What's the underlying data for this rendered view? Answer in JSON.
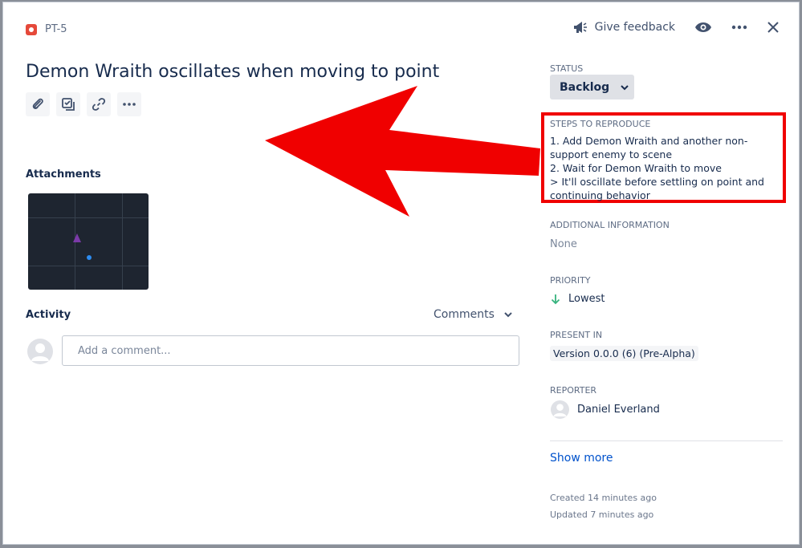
{
  "issue": {
    "key": "PT-5",
    "title": "Demon Wraith oscillates when moving to point"
  },
  "top_actions": {
    "feedback_label": "Give feedback"
  },
  "sections": {
    "attachments": "Attachments",
    "activity": "Activity"
  },
  "activity": {
    "filter_label": "Comments",
    "comment_placeholder": "Add a comment..."
  },
  "sidebar": {
    "status_label": "STATUS",
    "status_value": "Backlog",
    "steps_label": "STEPS TO REPRODUCE",
    "steps_lines": [
      "1. Add Demon Wraith and another non-",
      "support enemy to scene",
      "2. Wait for Demon Wraith to move",
      "> It'll oscillate before settling on point and",
      "continuing behavior"
    ],
    "additional_label": "ADDITIONAL INFORMATION",
    "additional_value": "None",
    "priority_label": "PRIORITY",
    "priority_value": "Lowest",
    "present_label": "PRESENT IN",
    "present_value": "Version 0.0.0 (6) (Pre-Alpha)",
    "reporter_label": "REPORTER",
    "reporter_value": "Daniel Everland",
    "show_more": "Show more",
    "created": "Created 14 minutes ago",
    "updated": "Updated 7 minutes ago"
  },
  "colors": {
    "annotation_red": "#f00000",
    "link_blue": "#0052cc",
    "priority_green": "#36b37e",
    "bug_red": "#e5493a"
  },
  "icons": [
    "bug-icon",
    "megaphone-icon",
    "eye-icon",
    "more-icon",
    "close-icon",
    "paperclip-icon",
    "checklist-icon",
    "link-icon",
    "chevron-down-icon",
    "arrow-down-icon",
    "user-avatar-icon"
  ]
}
